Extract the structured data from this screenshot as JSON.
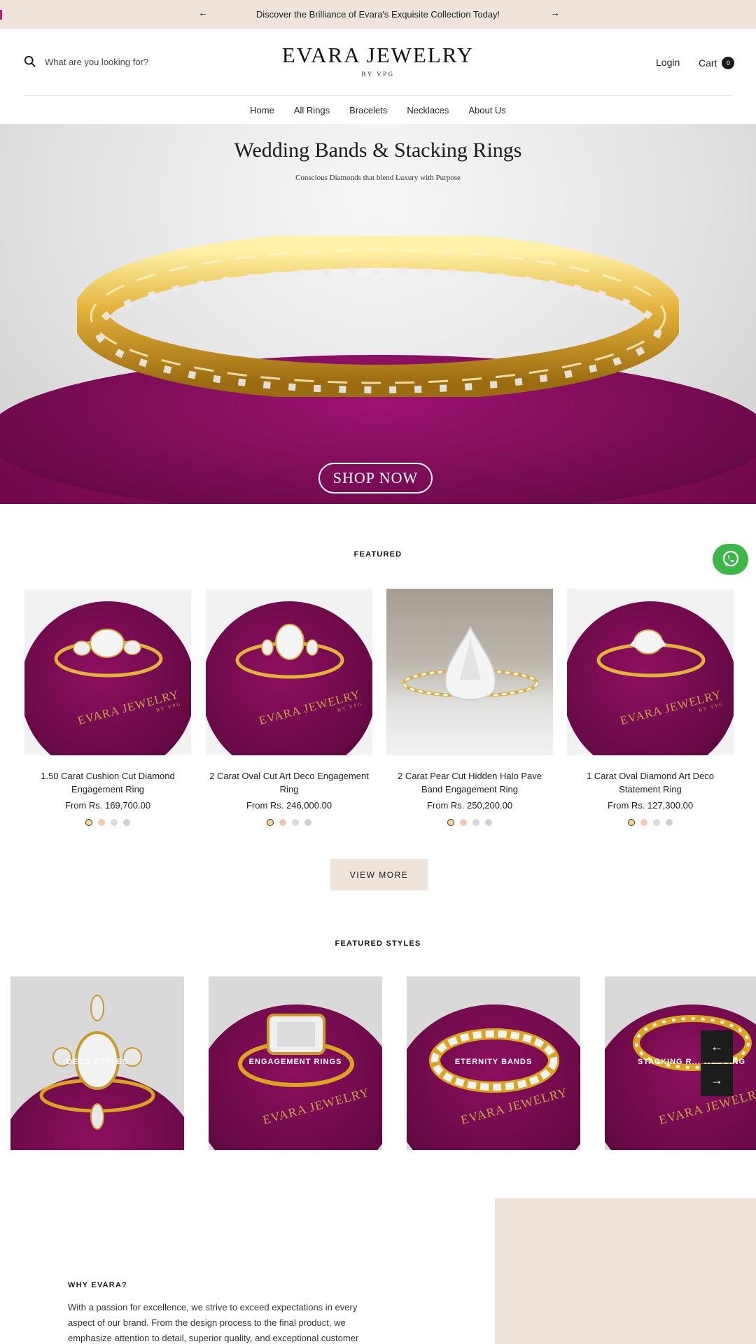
{
  "announcement": {
    "text": "Discover the Brilliance of Evara's Exquisite Collection Today!",
    "prev": "←",
    "next": "→"
  },
  "header": {
    "search_placeholder": "What are you looking for?",
    "logo_title": "EVARA JEWELRY",
    "logo_sub": "BY VPG",
    "login": "Login",
    "cart_label": "Cart",
    "cart_count": "0"
  },
  "nav": [
    "Home",
    "All Rings",
    "Bracelets",
    "Necklaces",
    "About Us"
  ],
  "hero": {
    "title": "Wedding Bands & Stacking Rings",
    "subtitle": "Conscious Diamonds that blend Luxury with Purpose",
    "cta": "SHOP NOW"
  },
  "featured": {
    "title": "FEATURED",
    "products": [
      {
        "name": "1.50 Carat Cushion Cut Diamond Engagement Ring",
        "price": "From Rs. 169,700.00"
      },
      {
        "name": "2 Carat Oval Cut Art Deco Engagement Ring",
        "price": "From Rs. 246,000.00"
      },
      {
        "name": "2 Carat Pear Cut Hidden Halo Pave Band Engagement Ring",
        "price": "From Rs. 250,200.00"
      },
      {
        "name": "1 Carat Oval Diamond Art Deco Statement Ring",
        "price": "From Rs. 127,300.00"
      }
    ],
    "image_brand": "EVARA JEWELRY",
    "image_brand_sub": "BY VPG",
    "swatch_colors": [
      "#f3d98b",
      "#f0c9b4",
      "#d9d9d9",
      "#d0d0d0"
    ],
    "view_more": "VIEW MORE"
  },
  "featured_styles": {
    "title": "FEATURED STYLES",
    "items": [
      "DECO STYLES",
      "ENGAGEMENT RINGS",
      "ETERNITY BANDS",
      "STACKING R... WEDDING"
    ],
    "image_brand": "EVARA JEWELRY",
    "prev": "←",
    "next": "→"
  },
  "why": {
    "title": "WHY EVARA?",
    "text": "With a passion for excellence, we strive to exceed expectations in every aspect of our brand. From the design process to the final product, we emphasize attention to detail, superior quality, and exceptional customer"
  },
  "colors": {
    "accent_beige": "#efe3dc",
    "velvet": "#7a0a52",
    "gold": "#d9a520",
    "whatsapp": "#3db64a"
  }
}
